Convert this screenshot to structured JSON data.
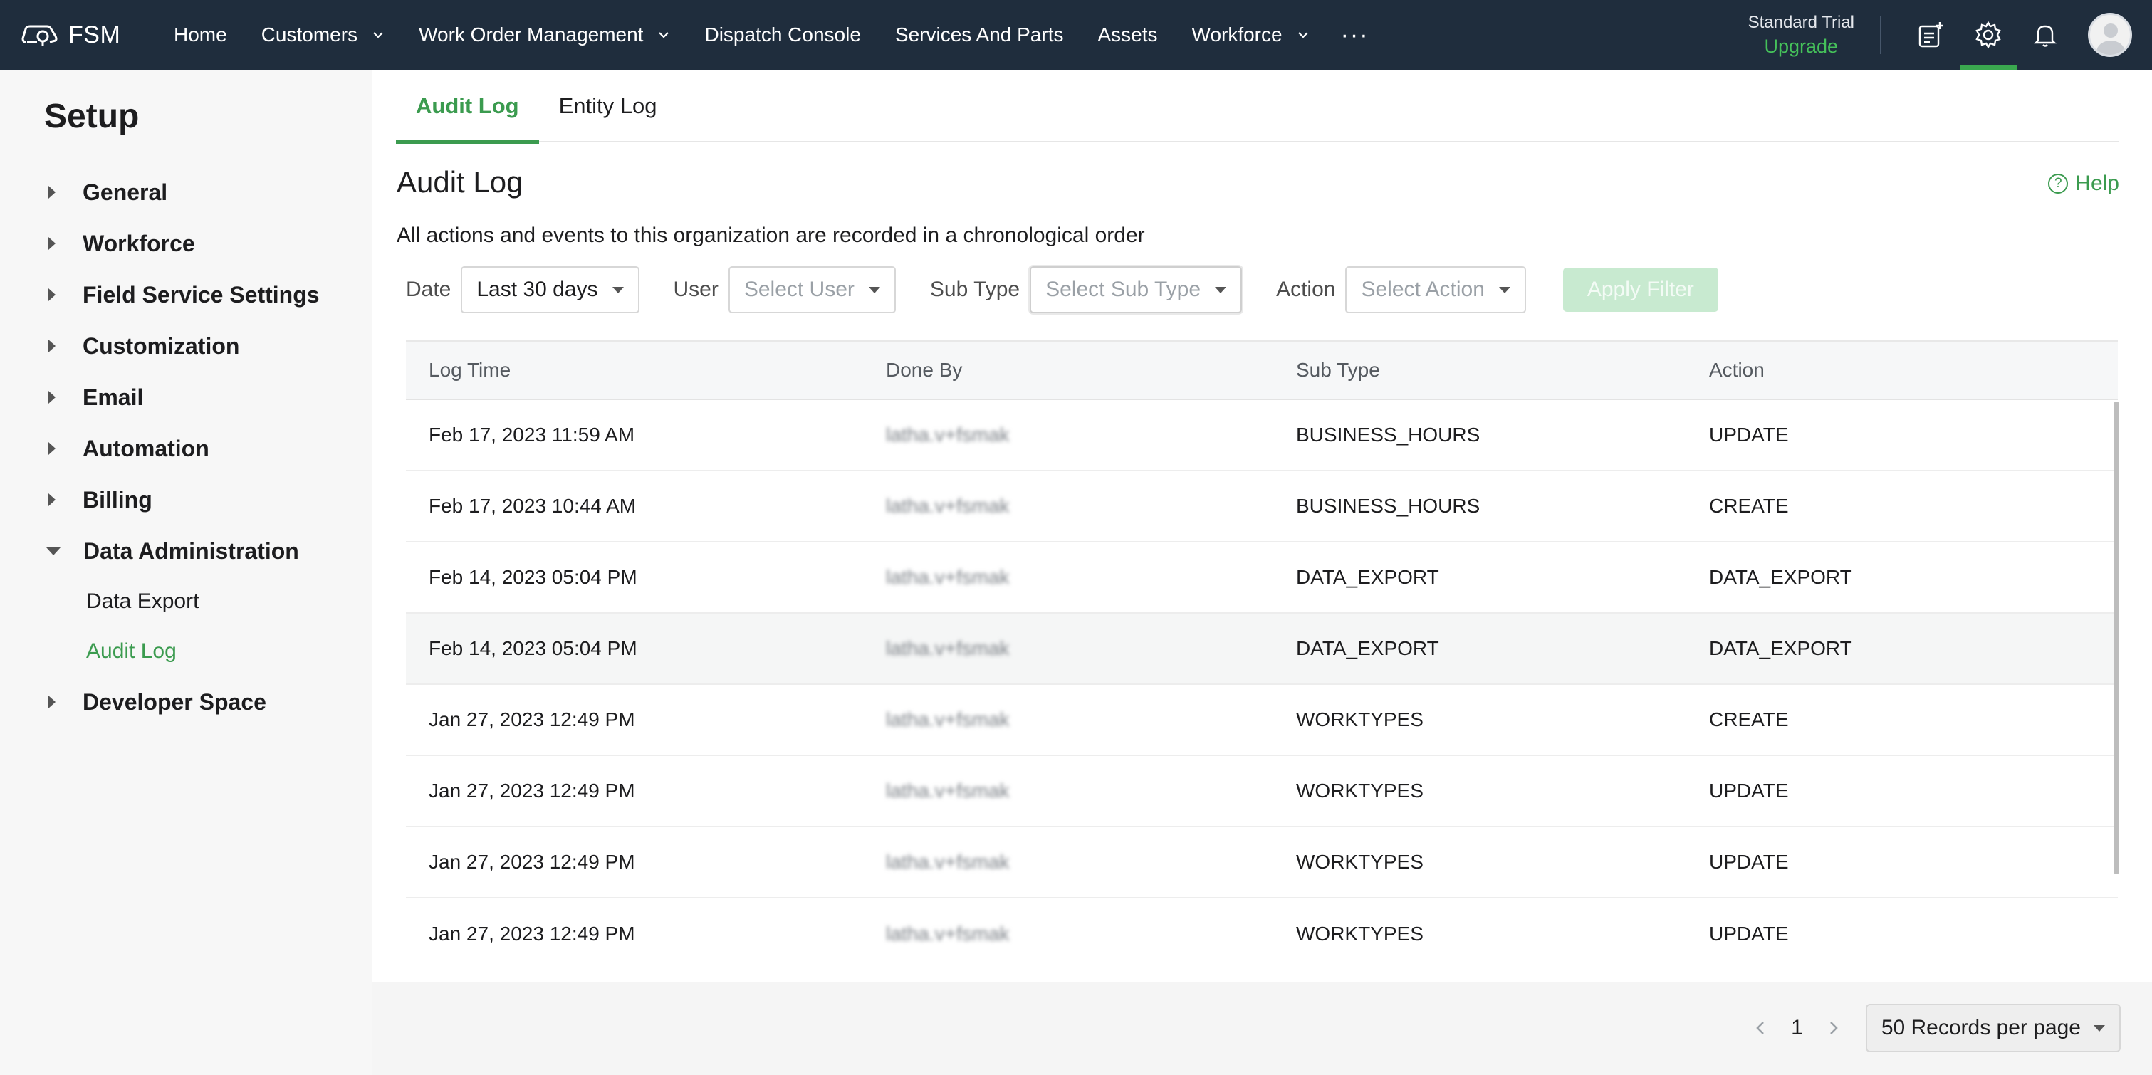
{
  "app": {
    "brand": "FSM",
    "nav": [
      {
        "label": "Home",
        "dropdown": false
      },
      {
        "label": "Customers",
        "dropdown": true
      },
      {
        "label": "Work Order Management",
        "dropdown": true
      },
      {
        "label": "Dispatch Console",
        "dropdown": false
      },
      {
        "label": "Services And Parts",
        "dropdown": false
      },
      {
        "label": "Assets",
        "dropdown": false
      },
      {
        "label": "Workforce",
        "dropdown": true
      }
    ],
    "more": "···",
    "trial_label": "Standard Trial",
    "upgrade_label": "Upgrade",
    "accent": "#3b9b4f",
    "topbar_color": "#1f2d3d"
  },
  "sidebar": {
    "title": "Setup",
    "items": [
      {
        "label": "General",
        "expanded": false
      },
      {
        "label": "Workforce",
        "expanded": false
      },
      {
        "label": "Field Service Settings",
        "expanded": false
      },
      {
        "label": "Customization",
        "expanded": false
      },
      {
        "label": "Email",
        "expanded": false
      },
      {
        "label": "Automation",
        "expanded": false
      },
      {
        "label": "Billing",
        "expanded": false
      },
      {
        "label": "Data Administration",
        "expanded": true
      },
      {
        "label": "Developer Space",
        "expanded": false
      }
    ],
    "sub_items": [
      {
        "label": "Data Export",
        "active": false
      },
      {
        "label": "Audit Log",
        "active": true
      }
    ]
  },
  "tabs": [
    {
      "label": "Audit Log",
      "active": true
    },
    {
      "label": "Entity Log",
      "active": false
    }
  ],
  "page": {
    "title": "Audit Log",
    "help": "Help",
    "description": "All actions and events to this organization are recorded in a chronological order"
  },
  "filters": {
    "date_label": "Date",
    "date_value": "Last 30 days",
    "user_label": "User",
    "user_placeholder": "Select User",
    "subtype_label": "Sub Type",
    "subtype_placeholder": "Select Sub Type",
    "action_label": "Action",
    "action_placeholder": "Select Action",
    "apply_label": "Apply Filter"
  },
  "table": {
    "columns": [
      "Log Time",
      "Done By",
      "Sub Type",
      "Action"
    ],
    "rows": [
      [
        "Feb 17, 2023 11:59 AM",
        "latha.v+fsmak",
        "BUSINESS_HOURS",
        "UPDATE"
      ],
      [
        "Feb 17, 2023 10:44 AM",
        "latha.v+fsmak",
        "BUSINESS_HOURS",
        "CREATE"
      ],
      [
        "Feb 14, 2023 05:04 PM",
        "latha.v+fsmak",
        "DATA_EXPORT",
        "DATA_EXPORT"
      ],
      [
        "Feb 14, 2023 05:04 PM",
        "latha.v+fsmak",
        "DATA_EXPORT",
        "DATA_EXPORT"
      ],
      [
        "Jan 27, 2023 12:49 PM",
        "latha.v+fsmak",
        "WORKTYPES",
        "CREATE"
      ],
      [
        "Jan 27, 2023 12:49 PM",
        "latha.v+fsmak",
        "WORKTYPES",
        "UPDATE"
      ],
      [
        "Jan 27, 2023 12:49 PM",
        "latha.v+fsmak",
        "WORKTYPES",
        "UPDATE"
      ],
      [
        "Jan 27, 2023 12:49 PM",
        "latha.v+fsmak",
        "WORKTYPES",
        "UPDATE"
      ]
    ]
  },
  "pagination": {
    "page": "1",
    "per_page": "50 Records per page"
  }
}
